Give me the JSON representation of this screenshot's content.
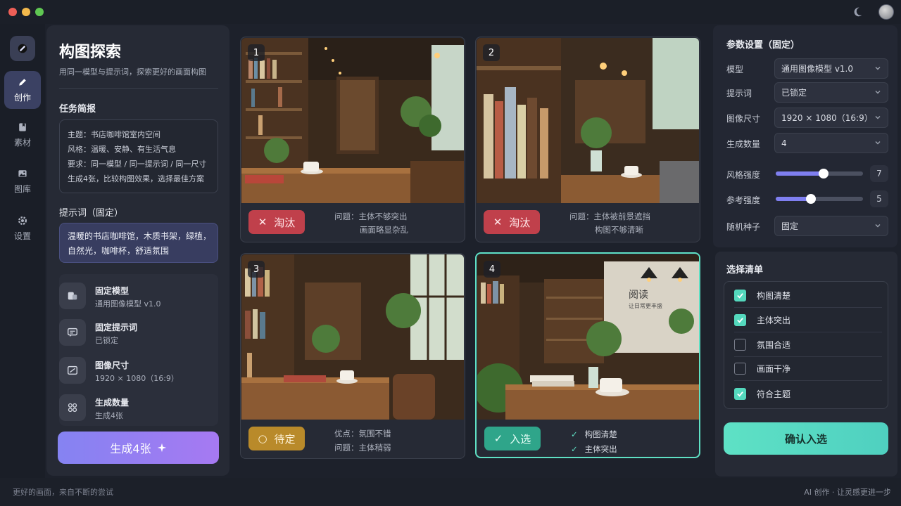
{
  "window": {
    "dots": [
      "#ee5f57",
      "#f3b94c",
      "#5fc752"
    ]
  },
  "rail": {
    "items": [
      {
        "label": "创作",
        "icon": "pencil-icon",
        "active": true
      },
      {
        "label": "素材",
        "icon": "bookmark-icon",
        "active": false
      },
      {
        "label": "图库",
        "icon": "image-icon",
        "active": false
      },
      {
        "label": "设置",
        "icon": "gear-icon",
        "active": false
      }
    ]
  },
  "left_panel": {
    "title": "构图探索",
    "subtitle": "用同一模型与提示词，探索更好的画面构图",
    "brief_title": "任务简报",
    "brief_lines": [
      "主题：书店咖啡馆室内空间",
      "风格：温暖、安静、有生活气息",
      "要求：同一模型 / 同一提示词 / 同一尺寸",
      "生成4张，比较构图效果，选择最佳方案"
    ],
    "prompt_title": "提示词（固定）",
    "prompt_lines": [
      "温暖的书店咖啡馆，木质书架，绿植，",
      "自然光，咖啡杯，舒适氛围"
    ],
    "fixed_items": [
      {
        "title": "固定模型",
        "value": "通用图像模型 v1.0",
        "icon": "model-icon"
      },
      {
        "title": "固定提示词",
        "value": "已锁定",
        "icon": "prompt-icon"
      },
      {
        "title": "图像尺寸",
        "value": "1920 × 1080（16:9）",
        "icon": "image-size-icon"
      },
      {
        "title": "生成数量",
        "value": "生成4张",
        "icon": "grid-icon"
      }
    ],
    "generate_label": "生成4张"
  },
  "cards": [
    {
      "num": "1",
      "status": "淘汰",
      "status_type": "reject",
      "lines": [
        "问题：主体不够突出",
        "画面略显杂乱"
      ]
    },
    {
      "num": "2",
      "status": "淘汰",
      "status_type": "reject",
      "lines": [
        "问题：主体被前景遮挡",
        "构图不够清晰"
      ]
    },
    {
      "num": "3",
      "status": "待定",
      "status_type": "pending",
      "lines": [
        "优点：氛围不错",
        "问题：主体稍弱"
      ]
    },
    {
      "num": "4",
      "status": "入选",
      "status_type": "accept",
      "lines": [
        "构图清楚",
        "主体突出"
      ],
      "sign": [
        "阅读",
        "让日常更丰盛"
      ]
    }
  ],
  "params": {
    "title": "参数设置（固定）",
    "rows": [
      {
        "label": "模型",
        "value": "通用图像模型 v1.0"
      },
      {
        "label": "提示词",
        "value": "已锁定"
      },
      {
        "label": "图像尺寸",
        "value": "1920 × 1080（16:9）"
      },
      {
        "label": "生成数量",
        "value": "4"
      }
    ],
    "sliders": [
      {
        "label": "风格强度",
        "value": "7",
        "fraction": 0.55
      },
      {
        "label": "参考强度",
        "value": "5",
        "fraction": 0.4
      }
    ],
    "seed": {
      "label": "随机种子",
      "value": "固定"
    }
  },
  "checklist": {
    "title": "选择清单",
    "items": [
      {
        "label": "构图清楚",
        "checked": true
      },
      {
        "label": "主体突出",
        "checked": true
      },
      {
        "label": "氛围合适",
        "checked": false
      },
      {
        "label": "画面干净",
        "checked": false
      },
      {
        "label": "符合主题",
        "checked": true
      }
    ],
    "confirm_label": "确认入选"
  },
  "footer": {
    "left": "更好的画面，来自不断的尝试",
    "right": "AI 创作 · 让灵感更进一步"
  }
}
